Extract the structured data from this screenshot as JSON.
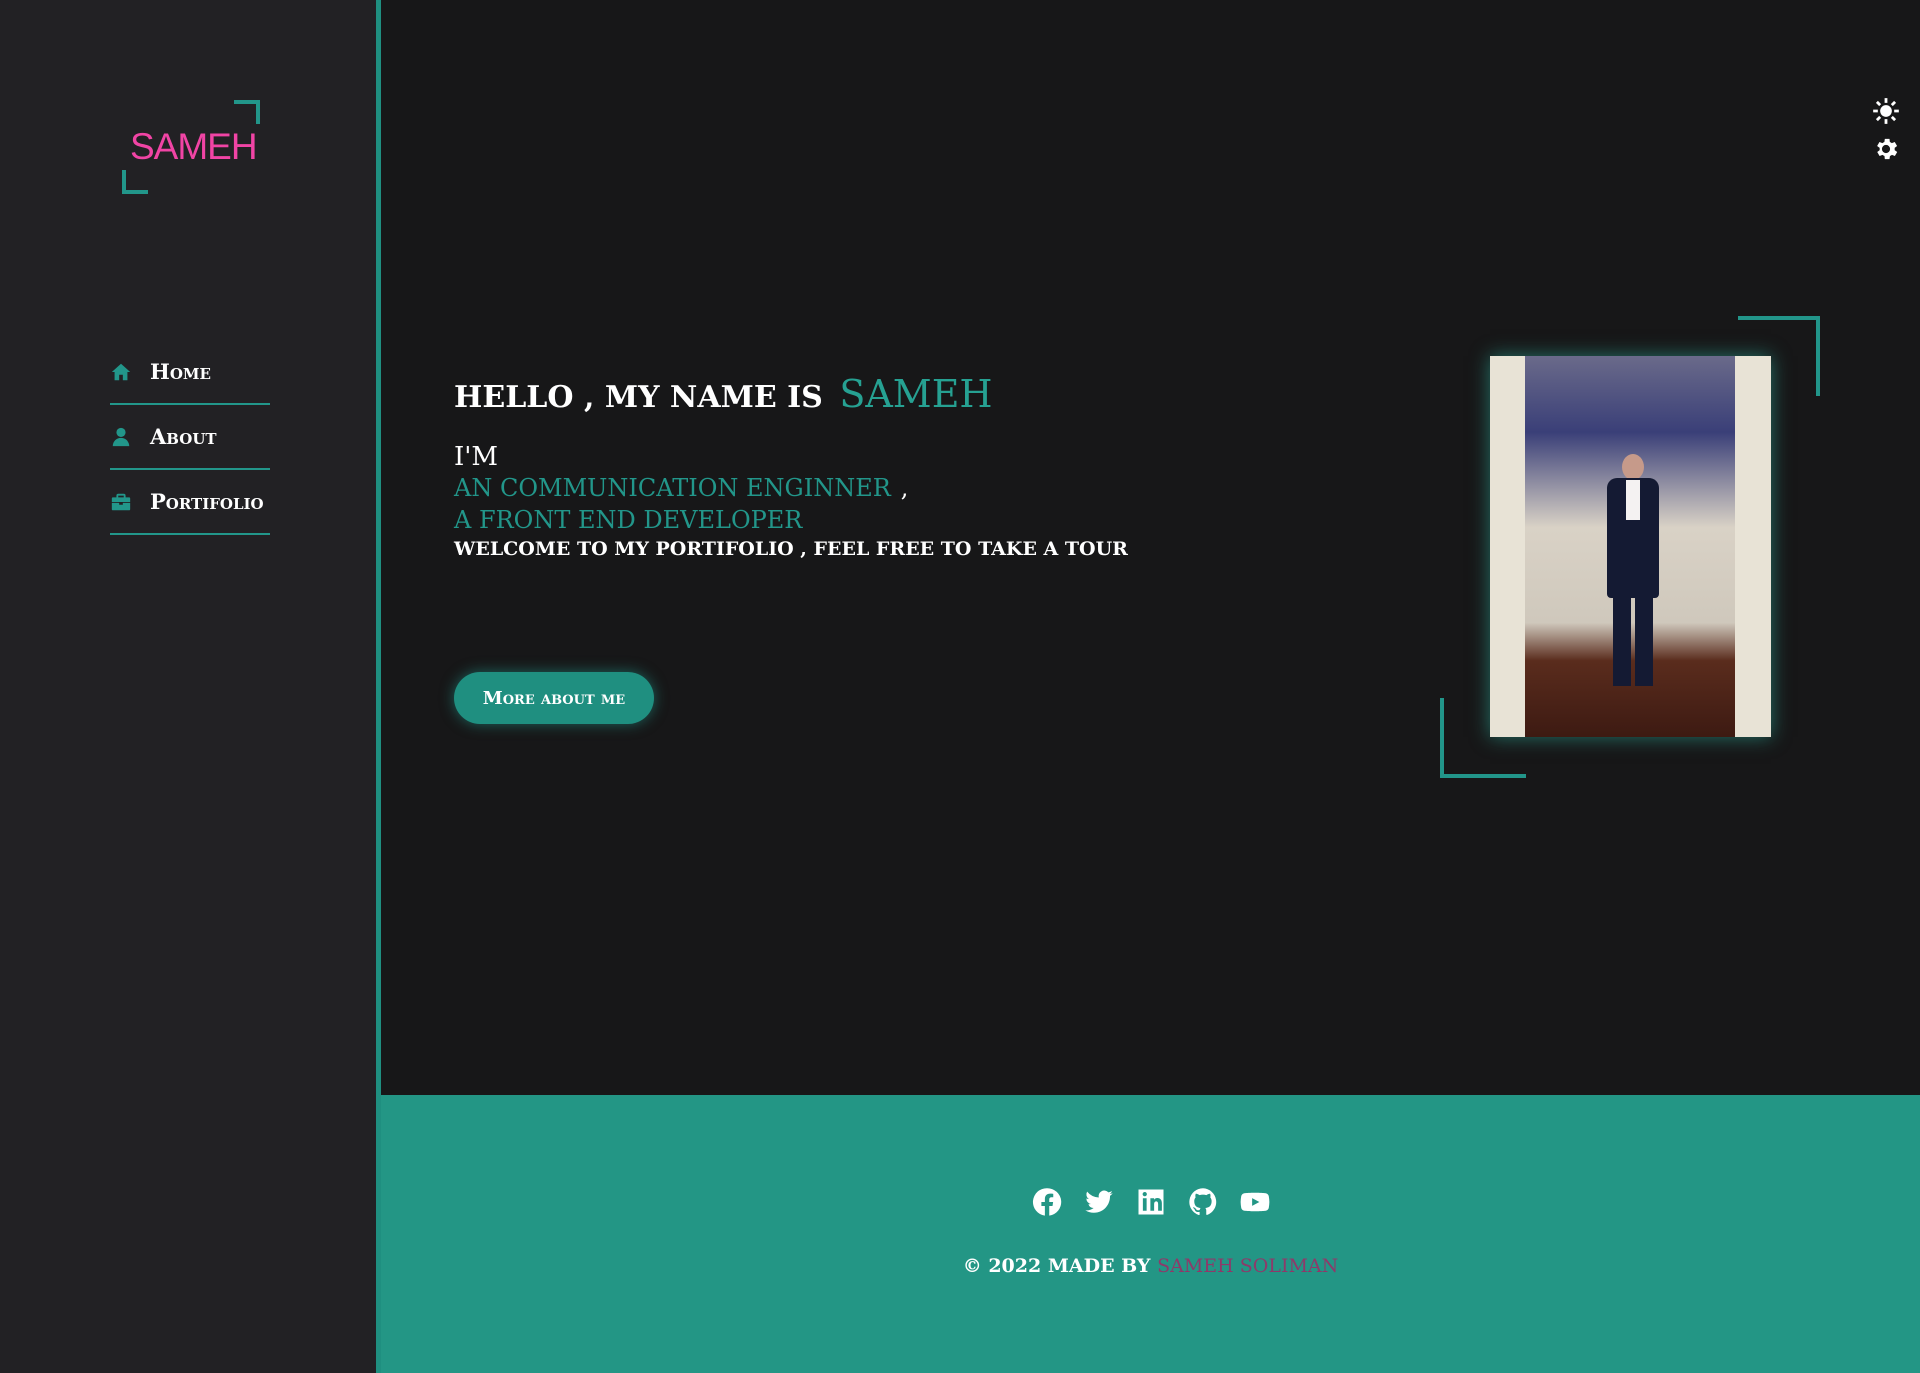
{
  "logo": {
    "text": "SAMEH"
  },
  "nav": {
    "items": [
      {
        "label": "Home",
        "icon": "home-icon"
      },
      {
        "label": "About",
        "icon": "user-icon"
      },
      {
        "label": "Portifolio",
        "icon": "briefcase-icon"
      }
    ]
  },
  "settings": {
    "icons": [
      "sun-icon",
      "gear-icon"
    ]
  },
  "hero": {
    "greeting": "HELLO , MY NAME IS",
    "name": "SAMEH",
    "im": "I'M",
    "role1": "AN COMMUNICATION ENGINNER",
    "role1_sep": ",",
    "role2": "A FRONT END DEVELOPER",
    "welcome": "WELCOME TO MY PORTIFOLIO , FEEL FREE TO TAKE A TOUR",
    "cta": "More about me"
  },
  "footer": {
    "socials": [
      "facebook-icon",
      "twitter-icon",
      "linkedin-icon",
      "github-icon",
      "youtube-icon"
    ],
    "credit_prefix": "© 2022 MADE BY",
    "author": "SAMEH SOLIMAN"
  },
  "colors": {
    "accent": "#22968a",
    "logo": "#f144a5",
    "sidebar": "#222124",
    "background": "#171718",
    "footer": "#239685"
  }
}
